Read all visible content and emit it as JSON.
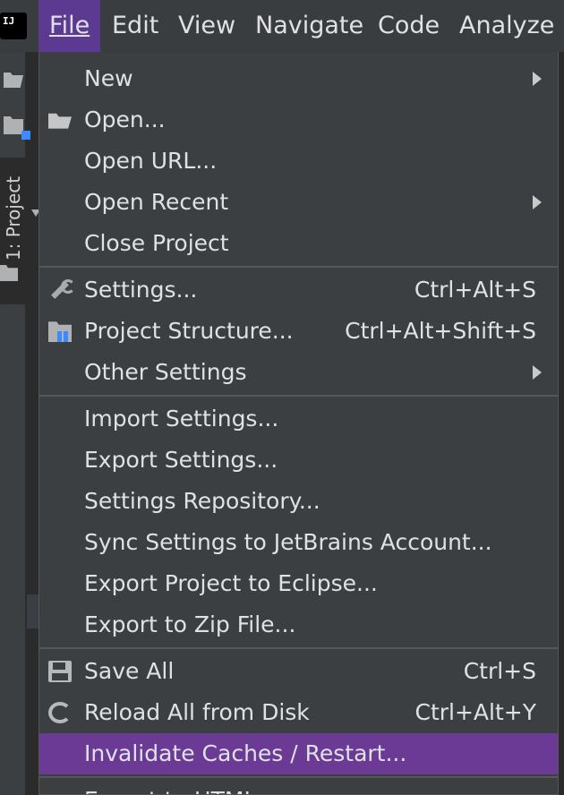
{
  "menubar": {
    "logo_text": "IJ",
    "items": [
      {
        "label": "File",
        "active": true
      },
      {
        "label": "Edit"
      },
      {
        "label": "View"
      },
      {
        "label": "Navigate"
      },
      {
        "label": "Code"
      },
      {
        "label": "Analyze"
      }
    ]
  },
  "tool_window": {
    "project_tab_label": "1: Project"
  },
  "file_menu": {
    "items": [
      {
        "label": "New",
        "submenu": true
      },
      {
        "label": "Open...",
        "icon": "folder-open-icon"
      },
      {
        "label": "Open URL..."
      },
      {
        "label": "Open Recent",
        "submenu": true
      },
      {
        "label": "Close Project"
      },
      {
        "label": "Settings...",
        "shortcut": "Ctrl+Alt+S",
        "icon": "wrench-icon"
      },
      {
        "label": "Project Structure...",
        "shortcut": "Ctrl+Alt+Shift+S",
        "icon": "project-structure-icon"
      },
      {
        "label": "Other Settings",
        "submenu": true
      },
      {
        "label": "Import Settings..."
      },
      {
        "label": "Export Settings..."
      },
      {
        "label": "Settings Repository..."
      },
      {
        "label": "Sync Settings to JetBrains Account..."
      },
      {
        "label": "Export Project to Eclipse..."
      },
      {
        "label": "Export to Zip File..."
      },
      {
        "label": "Save All",
        "shortcut": "Ctrl+S",
        "icon": "save-icon"
      },
      {
        "label": "Reload All from Disk",
        "shortcut": "Ctrl+Alt+Y",
        "icon": "reload-icon"
      },
      {
        "label": "Invalidate Caches / Restart...",
        "selected": true
      },
      {
        "label": "Export to HTML..."
      }
    ]
  },
  "colors": {
    "menubar_bg": "#3a3d40",
    "active_menu_bg": "#5c3a92",
    "dropdown_bg": "#3c3f41",
    "selected_item_bg": "#6b3a94",
    "text": "#dfe1e5"
  }
}
